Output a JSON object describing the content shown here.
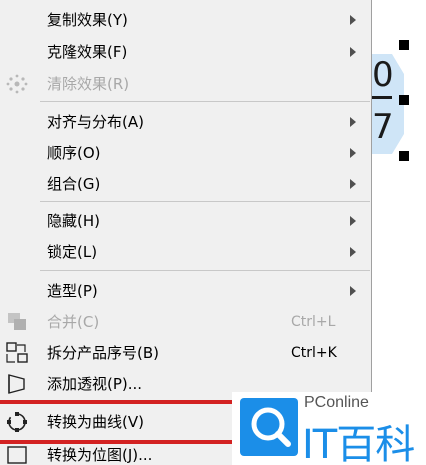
{
  "menu": {
    "items": [
      {
        "label": "复制效果(Y)",
        "submenu": true,
        "disabled": false
      },
      {
        "label": "克隆效果(F)",
        "submenu": true,
        "disabled": false
      },
      {
        "label": "清除效果(R)",
        "submenu": false,
        "disabled": true,
        "icon": "clear-effect-icon"
      },
      {
        "label": "对齐与分布(A)",
        "submenu": true,
        "disabled": false
      },
      {
        "label": "顺序(O)",
        "submenu": true,
        "disabled": false
      },
      {
        "label": "组合(G)",
        "submenu": true,
        "disabled": false
      },
      {
        "label": "隐藏(H)",
        "submenu": true,
        "disabled": false
      },
      {
        "label": "锁定(L)",
        "submenu": true,
        "disabled": false
      },
      {
        "label": "造型(P)",
        "submenu": true,
        "disabled": false
      },
      {
        "label": "合并(C)",
        "shortcut": "Ctrl+L",
        "disabled": true,
        "icon": "combine-icon"
      },
      {
        "label": "拆分产品序号(B)",
        "shortcut": "Ctrl+K",
        "disabled": false,
        "icon": "break-apart-icon"
      },
      {
        "label": "添加透视(P)...",
        "disabled": false,
        "icon": "perspective-icon"
      },
      {
        "label": "转换为曲线(V)",
        "disabled": false,
        "icon": "convert-to-curves-icon"
      },
      {
        "label": "转换为位图(J)...",
        "disabled": false,
        "icon": "convert-to-bitmap-icon"
      }
    ]
  },
  "canvas": {
    "shape_text_top": "0",
    "shape_text_bottom": "7"
  },
  "watermark": {
    "small_text": "PConline",
    "big_text": "IT百科"
  },
  "colors": {
    "highlight": "#d32222",
    "menu_bg": "#f0f0f0",
    "disabled_text": "#a8a8a8",
    "brand_blue": "#1b8ee8",
    "shape_fill": "#cfe5f7"
  }
}
